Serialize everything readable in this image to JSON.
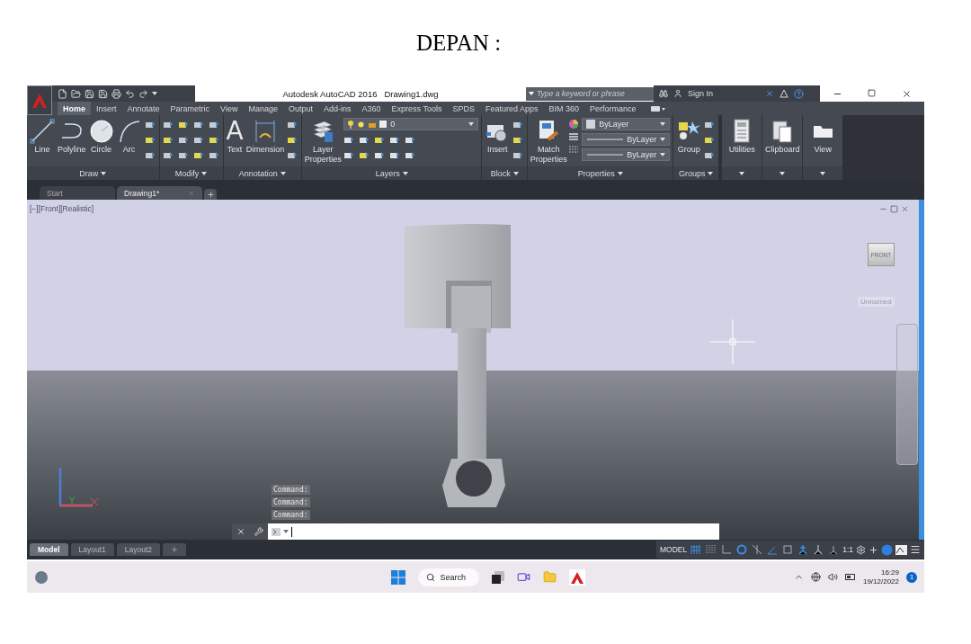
{
  "heading": "DEPAN :",
  "window": {
    "title": "Autodesk AutoCAD 2016",
    "file": "Drawing1.dwg",
    "search_placeholder": "Type a keyword or phrase",
    "sign_in": "Sign In"
  },
  "ribbon_tabs": [
    {
      "label": "Home",
      "selected": true
    },
    {
      "label": "Insert",
      "selected": false
    },
    {
      "label": "Annotate",
      "selected": false
    },
    {
      "label": "Parametric",
      "selected": false
    },
    {
      "label": "View",
      "selected": false
    },
    {
      "label": "Manage",
      "selected": false
    },
    {
      "label": "Output",
      "selected": false
    },
    {
      "label": "Add-ins",
      "selected": false
    },
    {
      "label": "A360",
      "selected": false
    },
    {
      "label": "Express Tools",
      "selected": false
    },
    {
      "label": "SPDS",
      "selected": false
    },
    {
      "label": "Featured Apps",
      "selected": false
    },
    {
      "label": "BIM 360",
      "selected": false
    },
    {
      "label": "Performance",
      "selected": false
    }
  ],
  "panels": [
    {
      "kind": "draw",
      "title": "Draw",
      "tools": [
        {
          "label": "Line",
          "kind": "line"
        },
        {
          "label": "Polyline",
          "kind": "polyline"
        },
        {
          "label": "Circle",
          "kind": "circle"
        },
        {
          "label": "Arc",
          "kind": "arc"
        }
      ]
    },
    {
      "kind": "modify",
      "title": "Modify"
    },
    {
      "kind": "annotation",
      "title": "Annotation",
      "tools": [
        {
          "label": "Text",
          "kind": "letter",
          "glyph": "A"
        },
        {
          "label": "Dimension",
          "kind": "dimension"
        }
      ]
    },
    {
      "kind": "layers",
      "title": "Layers",
      "tools": [
        {
          "label": "Layer Properties",
          "kind": "layers"
        }
      ],
      "dropdown": "0"
    },
    {
      "kind": "block",
      "title": "Block",
      "tools": [
        {
          "label": "Insert",
          "kind": "insert"
        }
      ]
    },
    {
      "kind": "properties",
      "title": "Properties",
      "tools": [
        {
          "label": "Match Properties",
          "kind": "match"
        }
      ],
      "dropdowns": [
        "ByLayer",
        "ByLayer",
        "ByLayer"
      ]
    },
    {
      "kind": "groups",
      "title": "Groups",
      "tools": [
        {
          "label": "Group",
          "kind": "group"
        }
      ]
    },
    {
      "kind": "single",
      "tools": [
        {
          "label": "Utilities",
          "kind": "calculator"
        }
      ]
    },
    {
      "kind": "single",
      "tools": [
        {
          "label": "Clipboard",
          "kind": "clipboard"
        }
      ]
    },
    {
      "kind": "single",
      "tools": [
        {
          "label": "View",
          "kind": "folder"
        }
      ]
    }
  ],
  "file_tabs": [
    {
      "label": "Start",
      "selected": false
    },
    {
      "label": "Drawing1*",
      "selected": true
    }
  ],
  "viewport": {
    "label": "[−][Front][Realistic]",
    "viewcube": "FRONT",
    "view_name": "Unnamed",
    "command_history": [
      "Command:",
      "Command:",
      "Command:"
    ]
  },
  "layout_tabs": [
    {
      "label": "Model",
      "selected": true
    },
    {
      "label": "Layout1",
      "selected": false
    },
    {
      "label": "Layout2",
      "selected": false
    }
  ],
  "status_bar": {
    "model": "MODEL",
    "scale": "1:1",
    "toggles": [
      {
        "kind": "grid",
        "on": true
      },
      {
        "kind": "snap",
        "on": false
      },
      {
        "kind": "ortho",
        "on": false
      },
      {
        "kind": "polar",
        "on": true
      },
      {
        "kind": "track",
        "on": false
      },
      {
        "kind": "osnap",
        "on": true
      },
      {
        "kind": "osnap3d",
        "on": false
      },
      {
        "kind": "annovis",
        "on": true
      },
      {
        "kind": "autoscale",
        "on": false
      },
      {
        "kind": "annoscale",
        "on": false
      }
    ]
  },
  "taskbar": {
    "search": "Search",
    "time": "16:29",
    "date": "19/12/2022",
    "badge": "1"
  }
}
